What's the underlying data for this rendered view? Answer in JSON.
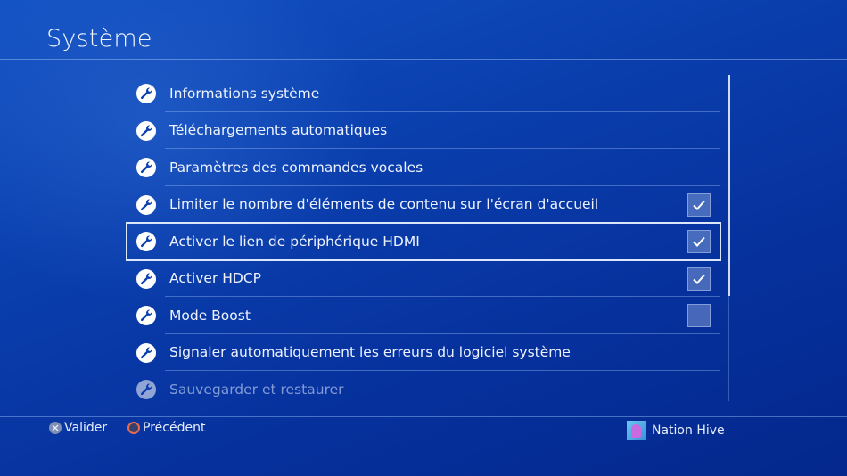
{
  "header": {
    "title": "Système"
  },
  "items": [
    {
      "label": "Informations système",
      "checkbox": null,
      "icon": "wrench-icon"
    },
    {
      "label": "Téléchargements automatiques",
      "checkbox": null,
      "icon": "wrench-icon"
    },
    {
      "label": "Paramètres des commandes vocales",
      "checkbox": null,
      "icon": "wrench-icon"
    },
    {
      "label": "Limiter le nombre d'éléments de contenu sur l'écran d'accueil",
      "checkbox": true,
      "icon": "wrench-icon"
    },
    {
      "label": "Activer le lien de périphérique HDMI",
      "checkbox": true,
      "icon": "wrench-icon",
      "selected": true
    },
    {
      "label": "Activer HDCP",
      "checkbox": true,
      "icon": "wrench-icon"
    },
    {
      "label": "Mode Boost",
      "checkbox": false,
      "icon": "wrench-icon"
    },
    {
      "label": "Signaler automatiquement les erreurs du logiciel système",
      "checkbox": null,
      "icon": "wrench-icon"
    },
    {
      "label": "Sauvegarder et restaurer",
      "checkbox": null,
      "icon": "wrench-icon",
      "faded": true
    }
  ],
  "footer": {
    "confirm_label": "Valider",
    "confirm_icon": "cross-button-icon",
    "back_label": "Précédent",
    "back_icon": "circle-button-icon",
    "user_name": "Nation Hive"
  },
  "colors": {
    "accent_selection": "#dbe6fb",
    "circle_button": "#e66a4f"
  }
}
